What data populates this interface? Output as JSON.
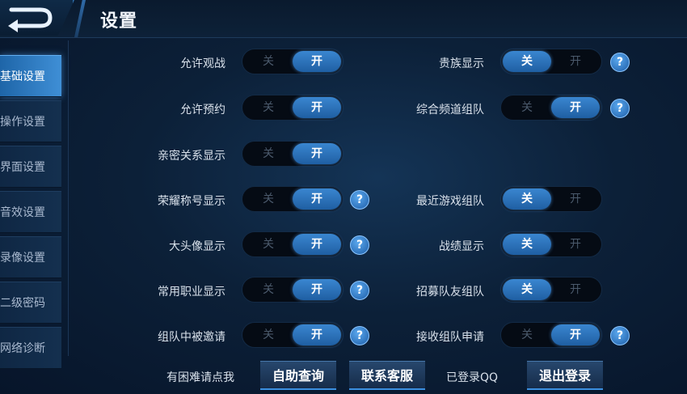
{
  "header": {
    "title": "设置"
  },
  "sidebar": {
    "items": [
      {
        "label": "基础设置",
        "active": true
      },
      {
        "label": "操作设置",
        "active": false
      },
      {
        "label": "界面设置",
        "active": false
      },
      {
        "label": "音效设置",
        "active": false
      },
      {
        "label": "录像设置",
        "active": false
      },
      {
        "label": "二级密码",
        "active": false
      },
      {
        "label": "网络诊断",
        "active": false
      }
    ]
  },
  "toggle_labels": {
    "off": "关",
    "on": "开"
  },
  "help_glyph": "?",
  "settings": {
    "left": [
      {
        "label": "允许观战",
        "state": "on",
        "help": false
      },
      {
        "label": "允许预约",
        "state": "on",
        "help": false
      },
      {
        "label": "亲密关系显示",
        "state": "on",
        "help": false
      },
      {
        "label": "荣耀称号显示",
        "state": "on",
        "help": true
      },
      {
        "label": "大头像显示",
        "state": "on",
        "help": true
      },
      {
        "label": "常用职业显示",
        "state": "on",
        "help": true
      },
      {
        "label": "组队中被邀请",
        "state": "on",
        "help": true
      }
    ],
    "right": [
      {
        "label": "贵族显示",
        "state": "off",
        "help": true
      },
      {
        "label": "综合频道组队",
        "state": "on",
        "help": true
      },
      null,
      {
        "label": "最近游戏组队",
        "state": "off",
        "help": false
      },
      {
        "label": "战绩显示",
        "state": "off",
        "help": false
      },
      {
        "label": "招募队友组队",
        "state": "off",
        "help": false
      },
      {
        "label": "接收组队申请",
        "state": "on",
        "help": true
      }
    ]
  },
  "footer": {
    "help_text": "有困难请点我",
    "self_service": "自助查询",
    "contact": "联系客服",
    "login_status": "已登录QQ",
    "logout": "退出登录"
  },
  "colors": {
    "accent": "#2f7bc8",
    "background": "#0c2038"
  }
}
